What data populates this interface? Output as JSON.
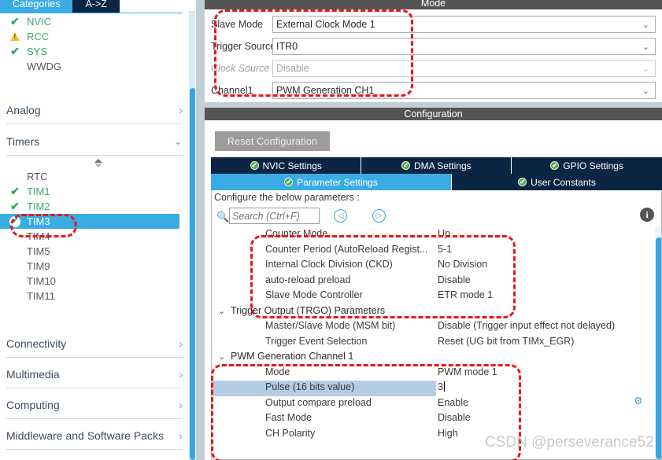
{
  "sidebar": {
    "tabs": [
      {
        "label": "Categories",
        "active": true
      },
      {
        "label": "A->Z",
        "active": false
      }
    ],
    "peripherals": [
      {
        "label": "NVIC",
        "status": "ok"
      },
      {
        "label": "RCC",
        "status": "warn"
      },
      {
        "label": "SYS",
        "status": "ok"
      },
      {
        "label": "WWDG",
        "status": "none"
      }
    ],
    "analog_section": {
      "label": "Analog",
      "chevron": "›"
    },
    "timers_section": {
      "label": "Timers",
      "chevron": "⌄"
    },
    "timers": [
      {
        "label": "RTC",
        "status": "none",
        "selected": false
      },
      {
        "label": "TIM1",
        "status": "ok",
        "selected": false
      },
      {
        "label": "TIM2",
        "status": "ok",
        "selected": false
      },
      {
        "label": "TIM3",
        "status": "ok-white",
        "selected": true
      },
      {
        "label": "TIM4",
        "status": "none",
        "selected": false
      },
      {
        "label": "TIM5",
        "status": "none",
        "selected": false
      },
      {
        "label": "TIM9",
        "status": "none",
        "selected": false
      },
      {
        "label": "TIM10",
        "status": "none",
        "selected": false
      },
      {
        "label": "TIM11",
        "status": "none",
        "selected": false
      }
    ],
    "sections": [
      {
        "label": "Connectivity",
        "chevron": "›"
      },
      {
        "label": "Multimedia",
        "chevron": "›"
      },
      {
        "label": "Computing",
        "chevron": "›"
      },
      {
        "label": "Middleware and Software Packs",
        "chevron": "›"
      }
    ]
  },
  "mode": {
    "title": "Mode",
    "rows": [
      {
        "label": "Slave Mode",
        "value": "External Clock Mode 1",
        "disabled": false
      },
      {
        "label": "Trigger Source",
        "value": "ITR0",
        "disabled": false
      },
      {
        "label": "Clock Source",
        "value": "Disable",
        "disabled": true
      },
      {
        "label": "Channel1",
        "value": "PWM Generation CH1",
        "disabled": false
      }
    ],
    "chevron": "⌄"
  },
  "configuration": {
    "title": "Configuration",
    "reset_label": "Reset Configuration",
    "tabs_row1": [
      {
        "label": "NVIC Settings",
        "active": false
      },
      {
        "label": "DMA Settings",
        "active": false
      },
      {
        "label": "GPIO Settings",
        "active": false
      }
    ],
    "tabs_row2": [
      {
        "label": "Parameter Settings",
        "active": true
      },
      {
        "label": "User Constants",
        "active": false
      }
    ],
    "hint": "Configure the below parameters :",
    "search_placeholder": "Search (Ctrl+F)",
    "prev_glyph": "◁",
    "next_glyph": "▷",
    "info_glyph": "i",
    "gear_glyph": "⚙"
  },
  "parameters": [
    {
      "type": "row",
      "label": "Counter Mode",
      "value": "Up",
      "selected": false
    },
    {
      "type": "row",
      "label": "Counter Period (AutoReload Regist...",
      "value": "5-1",
      "selected": false
    },
    {
      "type": "row",
      "label": "Internal Clock Division (CKD)",
      "value": "No Division",
      "selected": false
    },
    {
      "type": "row",
      "label": "auto-reload preload",
      "value": "Disable",
      "selected": false
    },
    {
      "type": "row",
      "label": "Slave Mode Controller",
      "value": "ETR mode 1",
      "selected": false
    },
    {
      "type": "group",
      "label": "Trigger Output (TRGO) Parameters",
      "value": "",
      "selected": false,
      "chevron": "⌄"
    },
    {
      "type": "row",
      "label": "Master/Slave Mode (MSM bit)",
      "value": "Disable (Trigger input effect not delayed)",
      "selected": false
    },
    {
      "type": "row",
      "label": "Trigger Event Selection",
      "value": "Reset (UG bit from TIMx_EGR)",
      "selected": false
    },
    {
      "type": "group",
      "label": "PWM Generation Channel 1",
      "value": "",
      "selected": false,
      "chevron": "⌄"
    },
    {
      "type": "row",
      "label": "Mode",
      "value": "PWM mode 1",
      "selected": false
    },
    {
      "type": "row",
      "label": "Pulse (16 bits value)",
      "value": "3",
      "selected": true
    },
    {
      "type": "row",
      "label": "Output compare preload",
      "value": "Enable",
      "selected": false
    },
    {
      "type": "row",
      "label": "Fast Mode",
      "value": "Disable",
      "selected": false
    },
    {
      "type": "row",
      "label": "CH Polarity",
      "value": "High",
      "selected": false
    }
  ],
  "watermark": "CSDN @perseverance52"
}
